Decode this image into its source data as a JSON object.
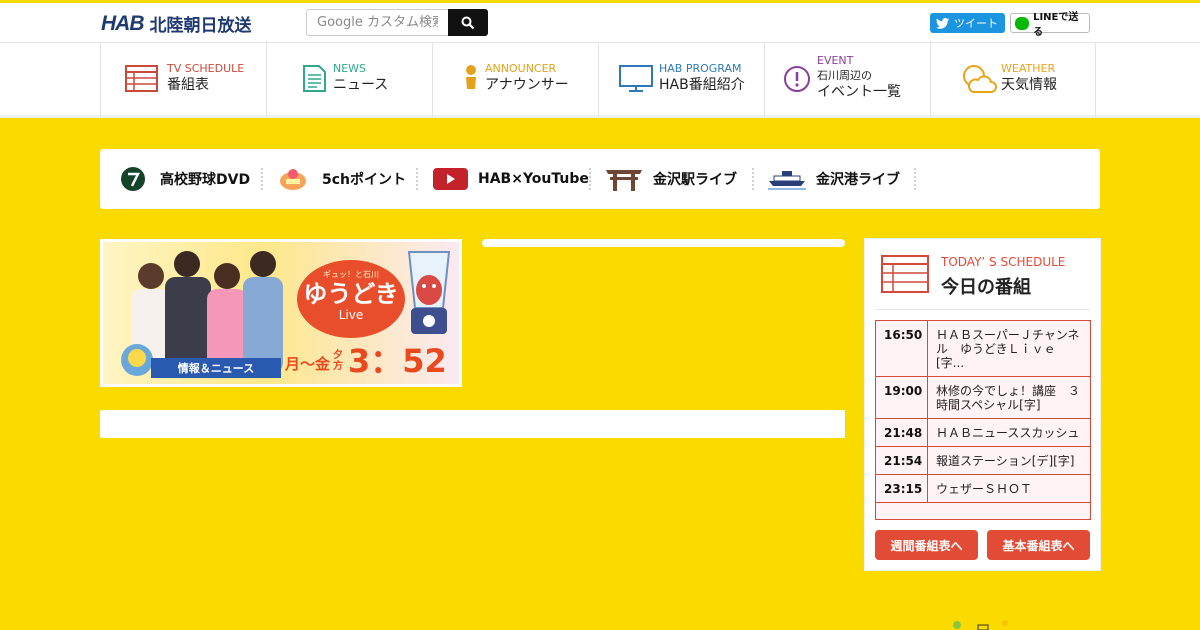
{
  "header": {
    "logo_mark": "HAB",
    "logo_name": "北陸朝日放送",
    "search_placeholder": "Google カスタム検索",
    "tweet_label": "ツイート",
    "line_label": "LINEで送る"
  },
  "nav": [
    {
      "en": "TV SCHEDULE",
      "ja": "番組表",
      "color": "#c94a3a"
    },
    {
      "en": "NEWS",
      "ja": "ニュース",
      "color": "#2fa890"
    },
    {
      "en": "ANNOUNCER",
      "ja": "アナウンサー",
      "color": "#e3a21a"
    },
    {
      "en": "HAB PROGRAM",
      "ja": "HAB番組紹介",
      "color": "#2e78b8"
    },
    {
      "en": "EVENT",
      "ja1": "石川周辺の",
      "ja2": "イベント一覧",
      "color": "#8a3f9e"
    },
    {
      "en": "WEATHER",
      "ja": "天気情報",
      "color": "#e8a317"
    }
  ],
  "quick_links": [
    {
      "label": "高校野球DVD"
    },
    {
      "label": "5chポイント"
    },
    {
      "label": "HAB×YouTube"
    },
    {
      "label": "金沢駅ライブ"
    },
    {
      "label": "金沢港ライブ"
    }
  ],
  "banner": {
    "show_title": "ゆうどき",
    "show_sub": "Live",
    "show_tag": "ギュッ！と石川",
    "info": "情報＆ニュース",
    "days": "月〜金",
    "time_label": "夕方",
    "time": "3：52"
  },
  "schedule": {
    "en_title": "TODAY’ S SCHEDULE",
    "ja_title": "今日の番組",
    "rows": [
      {
        "time": "16:50",
        "title": "ＨＡＢスーパーＪチャンネル　ゆうどきＬｉｖｅ[字..."
      },
      {
        "time": "19:00",
        "title": "林修の今でしょ！講座　３時間スペシャル[字]"
      },
      {
        "time": "21:48",
        "title": "ＨＡＢニューススカッシュ"
      },
      {
        "time": "21:54",
        "title": "報道ステーション[デ][字]"
      },
      {
        "time": "23:15",
        "title": "ウェザーＳＨＯＴ"
      }
    ],
    "weekly_btn": "週間番組表へ",
    "basic_btn": "基本番組表へ"
  },
  "colors": {
    "background": "#fbda00",
    "accent_red": "#e24c37",
    "brand_navy": "#1f3a70"
  }
}
